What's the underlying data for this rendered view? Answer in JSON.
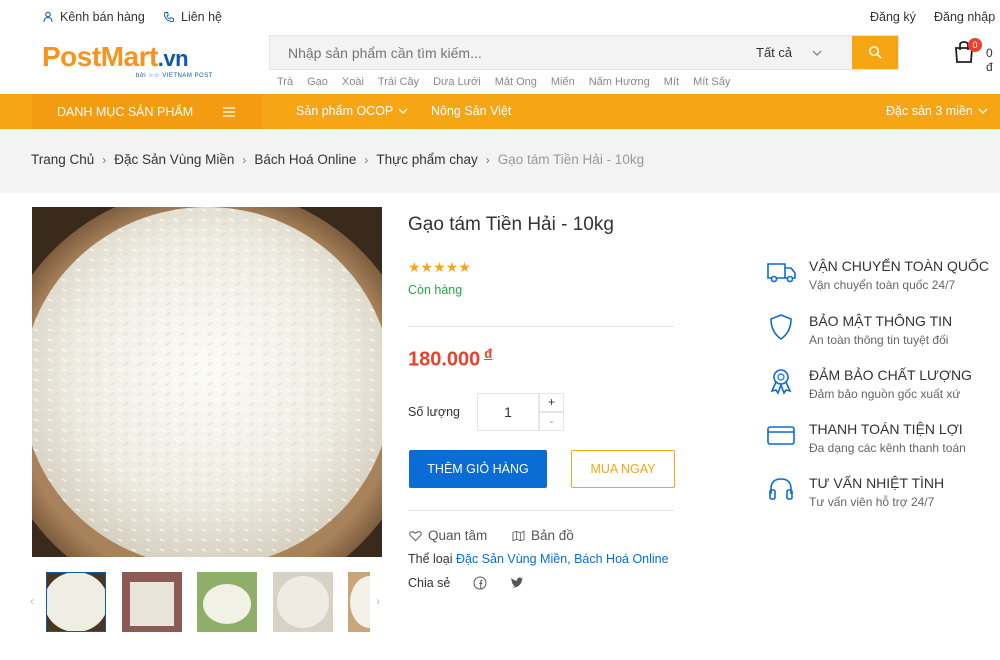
{
  "topbar": {
    "seller_channel": "Kênh bán hàng",
    "contact": "Liên hệ",
    "register": "Đăng ký",
    "login": "Đăng nhập"
  },
  "logo": {
    "main": "PostMart",
    "suffix": ".vn",
    "tagline": "bởi ☆☆ VIETNAM POST"
  },
  "search": {
    "placeholder": "Nhập sản phẩm cần tìm kiếm...",
    "category": "Tất cả",
    "tags": [
      "Trà",
      "Gạo",
      "Xoài",
      "Trái Cây",
      "Dưa Lưới",
      "Mật Ong",
      "Miến",
      "Nấm Hương",
      "Mít",
      "Mít Sấy"
    ]
  },
  "cart": {
    "badge": "0",
    "count": "0 đ"
  },
  "nav": {
    "categories": "Danh mục sản phẩm",
    "ocop": "Sản phẩm OCOP",
    "agri": "Nông Sản Việt",
    "specialty": "Đặc sản 3 miền"
  },
  "breadcrumb": {
    "items": [
      "Trang Chủ",
      "Đặc Sản Vùng Miền",
      "Bách Hoá Online",
      "Thực phẩm chay"
    ],
    "current": "Gạo tám Tiền Hải - 10kg"
  },
  "product": {
    "title": "Gạo tám Tiền Hải - 10kg",
    "rating": 5,
    "stars": "★★★★★",
    "stock": "Còn hàng",
    "price": "180.000",
    "currency": "đ",
    "qty_label": "Số lượng",
    "qty": "1",
    "plus": "+",
    "minus": "-",
    "add_to_cart": "Thêm giỏ hàng",
    "buy_now": "Mua ngay",
    "wishlist": "Quan tâm",
    "map": "Bản đồ",
    "category_label": "Thể loại",
    "categories": "Đặc Sản Vùng Miền, Bách Hoá Online",
    "share_label": "Chia sẻ"
  },
  "services": [
    {
      "title": "Vận chuyển toàn quốc",
      "sub": "Vận chuyển toàn quốc 24/7",
      "icon": "truck-icon"
    },
    {
      "title": "Bảo mật thông tin",
      "sub": "An toàn thông tin tuyệt đối",
      "icon": "shield-icon"
    },
    {
      "title": "Đảm bảo chất lượng",
      "sub": "Đảm bảo nguồn gốc xuất xứ",
      "icon": "award-icon"
    },
    {
      "title": "Thanh toán tiện lợi",
      "sub": "Đa dạng các kênh thanh toán",
      "icon": "credit-card-icon"
    },
    {
      "title": "Tư vấn nhiệt tình",
      "sub": "Tư vấn viên hỗ trợ 24/7",
      "icon": "headphones-icon"
    }
  ],
  "colors": {
    "brand_orange": "#f6a515",
    "brand_blue": "#0a5aa8",
    "price_red": "#e8412c",
    "button_blue": "#0a6cd4",
    "stock_green": "#28a745"
  }
}
